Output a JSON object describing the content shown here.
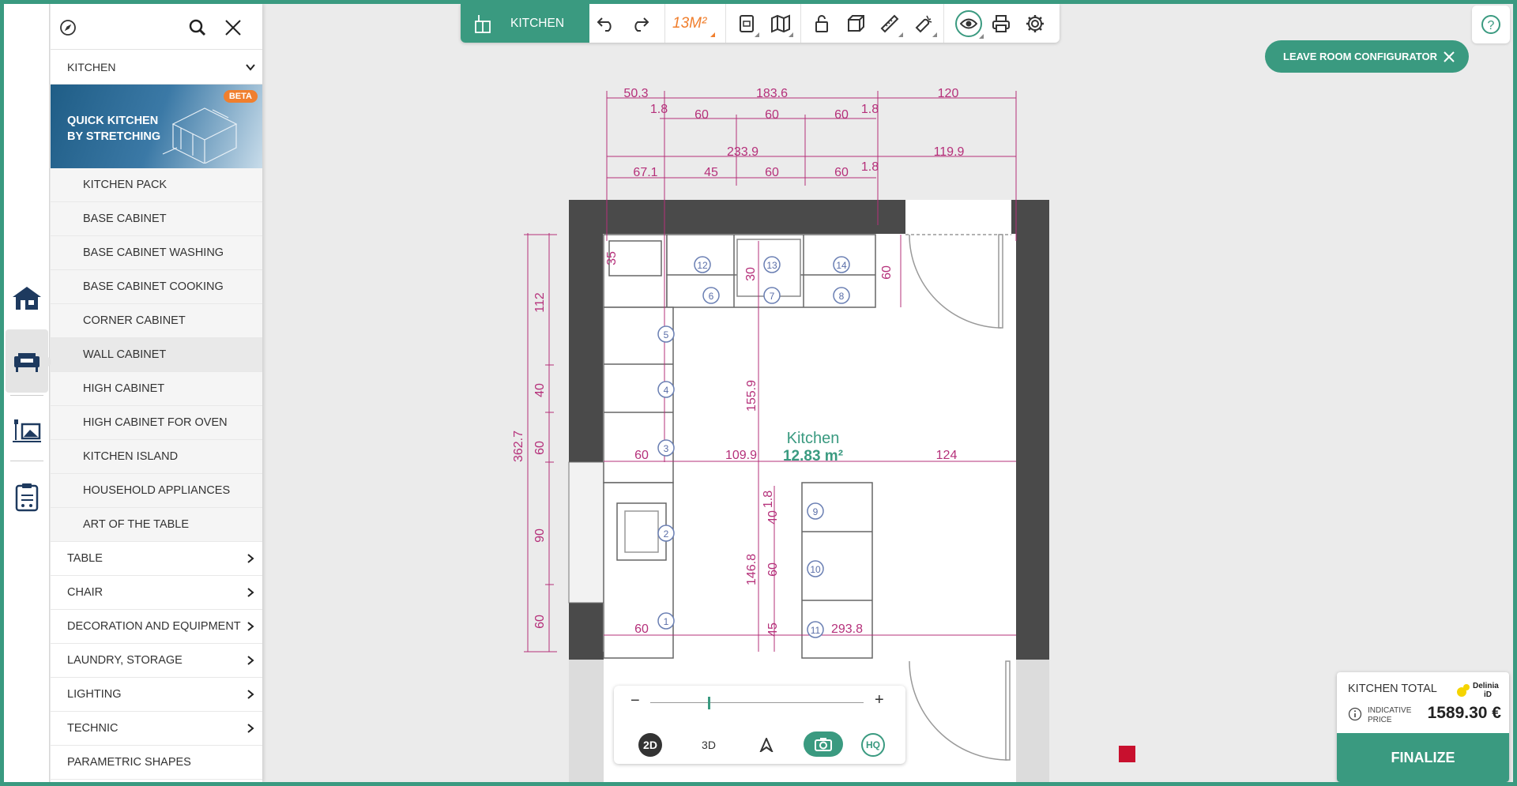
{
  "colors": {
    "accent": "#3a9a80",
    "orange": "#f07f2e",
    "dimension": "#b5307a",
    "wall": "#4a4a4a"
  },
  "toolbar": {
    "room_tab_label": "KITCHEN",
    "area_label": "13M²",
    "icons": [
      "undo-icon",
      "redo-icon",
      "document-icon",
      "map-icon",
      "lock-icon",
      "3d-box-icon",
      "ruler-icon",
      "magnet-icon",
      "eye-icon",
      "print-icon",
      "gear-icon"
    ]
  },
  "panel": {
    "category": "KITCHEN",
    "quick_banner": {
      "text": "QUICK KITCHEN\nBY STRETCHING",
      "badge": "BETA"
    },
    "sub_items": [
      "KITCHEN PACK",
      "BASE CABINET",
      "BASE CABINET WASHING",
      "BASE CABINET COOKING",
      "CORNER CABINET",
      "WALL CABINET",
      "HIGH CABINET",
      "HIGH CABINET FOR OVEN",
      "KITCHEN ISLAND",
      "HOUSEHOLD APPLIANCES",
      "ART OF THE TABLE"
    ],
    "main_items": [
      "TABLE",
      "CHAIR",
      "DECORATION AND EQUIPMENT",
      "LAUNDRY, STORAGE",
      "LIGHTING",
      "TECHNIC"
    ],
    "last_item": "PARAMETRIC SHAPES"
  },
  "leave_button": "LEAVE ROOM CONFIGURATOR",
  "plan": {
    "room_name": "Kitchen",
    "room_area": "12.83 m²",
    "dims_top_row1": [
      "50.3",
      "183.6",
      "120"
    ],
    "dims_top_row2": [
      "1.8",
      "60",
      "60",
      "60",
      "1.8"
    ],
    "dims_top_row3": [
      "233.9",
      "119.9"
    ],
    "dims_top_row4": [
      "67.1",
      "45",
      "60",
      "60",
      "1.8"
    ],
    "dims_left_outer": "362.7",
    "dims_left_inner": [
      "112",
      "40",
      "60",
      "90",
      "60"
    ],
    "dims_misc": [
      "35",
      "30",
      "60",
      "155.9",
      "109.9",
      "124",
      "60",
      "40",
      "1.8",
      "146.8",
      "60",
      "45",
      "293.8",
      "60"
    ],
    "item_numbers": [
      "1",
      "2",
      "3",
      "4",
      "5",
      "6",
      "7",
      "8",
      "9",
      "10",
      "11",
      "12",
      "13",
      "14"
    ]
  },
  "zoom": {
    "minus": "−",
    "plus": "+",
    "view_2d": "2D",
    "view_3d": "3D",
    "hq": "HQ"
  },
  "total": {
    "title": "KITCHEN TOTAL",
    "indicative": "INDICATIVE PRICE",
    "price": "1589.30 €",
    "finalize": "FINALIZE",
    "brand": "Delinia iD"
  }
}
